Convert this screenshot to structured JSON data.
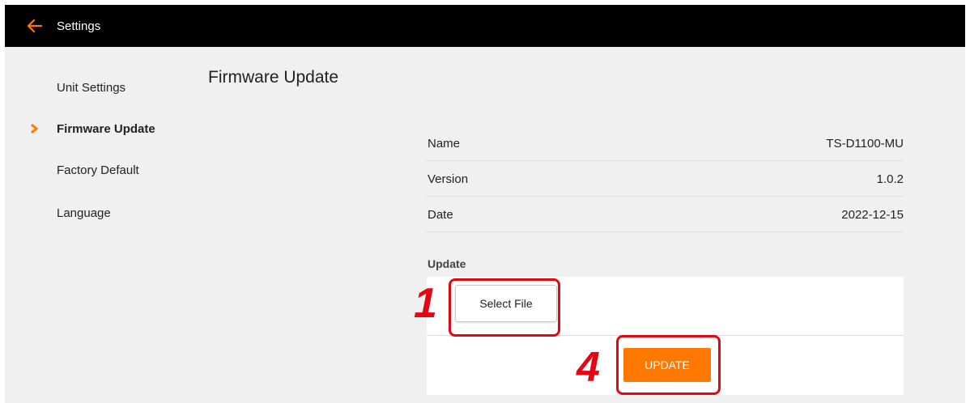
{
  "topbar": {
    "back_icon": "arrow-left-icon",
    "title": "Settings",
    "accent_color": "#ff7800"
  },
  "sidebar": {
    "items": [
      {
        "label": "Unit Settings"
      },
      {
        "label": "Firmware Update",
        "active": true
      },
      {
        "label": "Factory Default"
      },
      {
        "label": "Language"
      }
    ],
    "active_icon": "chevron-right-icon"
  },
  "main": {
    "title": "Firmware Update",
    "info": [
      {
        "label": "Name",
        "value": "TS-D1100-MU"
      },
      {
        "label": "Version",
        "value": "1.0.2"
      },
      {
        "label": "Date",
        "value": "2022-12-15"
      }
    ],
    "update_section": {
      "label": "Update",
      "select_file_label": "Select File",
      "update_button_label": "UPDATE",
      "update_button_color": "#ff7800"
    }
  },
  "callouts": [
    {
      "number": "1",
      "color": "#e30613"
    },
    {
      "number": "4",
      "color": "#e30613"
    }
  ]
}
